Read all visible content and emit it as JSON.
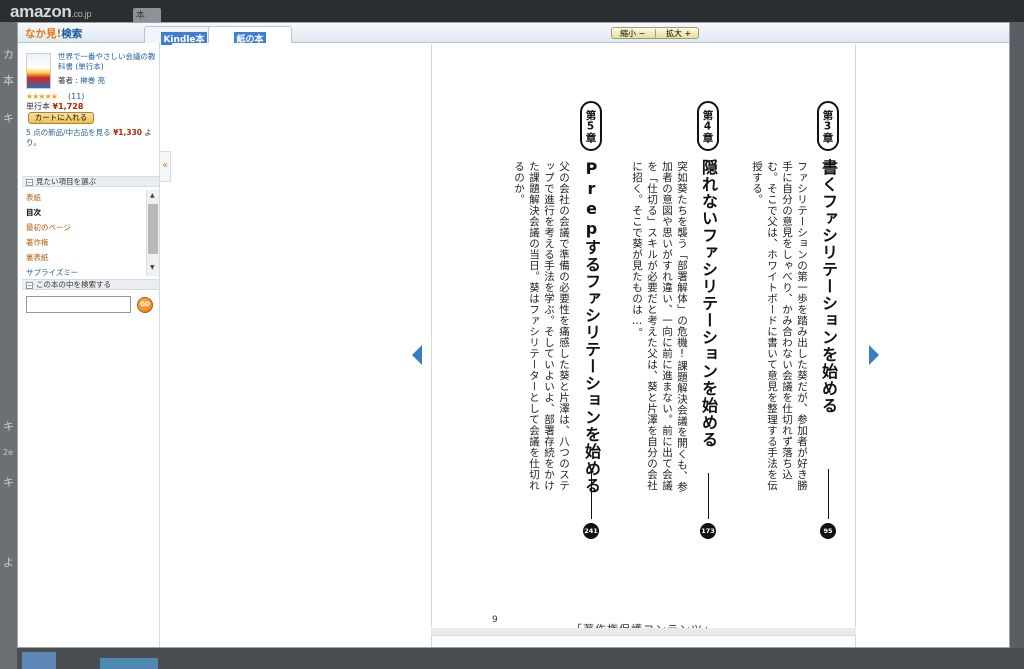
{
  "background": {
    "logo": "amazon",
    "logo_suffix": ".co.jp",
    "search_stub": "本",
    "left_glyphs": [
      "カ",
      "本",
      "キ",
      "キ",
      "2e",
      "キ",
      "よ"
    ]
  },
  "viewer": {
    "brand_prefix": "なか見!",
    "brand_search": "検索",
    "tabs": [
      {
        "label": "Kindle本",
        "selected": false
      },
      {
        "label": "紙の本",
        "selected": true
      }
    ],
    "zoom_out": "縮小 −",
    "zoom_in": "拡大 +"
  },
  "sidebar": {
    "book_title": "世界で一番やさしい会議の教科書 (単行本)",
    "author_label": "著者 : ",
    "author": "榊巻 亮",
    "stars": "★★★★★",
    "review_count": "(11)",
    "format_label": "単行本 ",
    "price": "¥1,728",
    "cart_button": "カートに入れる",
    "offers_text": "5 点の新品/中古品を見る ",
    "offers_price": "¥1,330",
    "offers_tail": " より。",
    "toc_section": "見たい項目を選ぶ",
    "toc_items": [
      "表紙",
      "目次",
      "最初のページ",
      "著作権",
      "裏表紙",
      "サプライズミー"
    ],
    "search_section": "この本の中を検索する",
    "search_placeholder": "",
    "go_label": "GO",
    "collapse_icon": "«"
  },
  "page": {
    "page_number": "9",
    "copyright": "「著作権保護コンテンツ」",
    "chapters": [
      {
        "badge": "第3章",
        "title": "書くファシリテーションを始める",
        "body": "ファシリテーションの第一歩を踏み出した葵だが、参加者が好き勝手に自分の意見をしゃべり、かみ合わない会議を仕切れず落ち込む。そこで父は、ホワイトボードに書いて意見を整理する手法を伝授する。",
        "page": "95"
      },
      {
        "badge": "第4章",
        "title": "隠れないファシリテーションを始める",
        "body": "突如葵たちを襲う「部署解体」の危機!課題解決会議を開くも、参加者の意図や思いがすれ違い、一向に前に進まない。前に出て会議を「仕切る」スキルが必要だと考えた父は、葵と片澤を自分の会社に招く。そこで葵が見たものは…。",
        "page": "173"
      },
      {
        "badge": "第5章",
        "title": "Prepするファシリテーションを始める",
        "body": "父の会社の会議で準備の必要性を痛感した葵と片澤は、八つのステップで進行を考える手法を学ぶ。そしていよいよ、部署存続をかけた課題解決会議の当日。葵はファシリテーターとして会議を仕切れるのか。",
        "page": "241"
      }
    ]
  }
}
